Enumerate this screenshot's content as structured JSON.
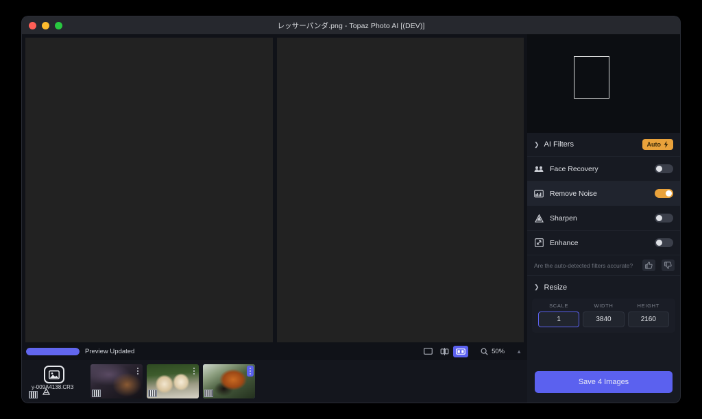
{
  "window": {
    "title": "レッサーパンダ.png - Topaz Photo AI [(DEV)]",
    "traffic_lights": [
      "close",
      "minimize",
      "zoom"
    ]
  },
  "statusbar": {
    "progress_label": "Preview Updated",
    "progress_percent": 100,
    "progress_color": "#6166ee",
    "view_modes": [
      {
        "name": "single-view",
        "icon": "rectangle-icon",
        "active": false
      },
      {
        "name": "split-view",
        "icon": "split-view-icon",
        "active": false
      },
      {
        "name": "side-by-side-view",
        "icon": "side-by-side-icon",
        "active": true
      }
    ],
    "zoom_icon": "magnifier-icon",
    "zoom_value": "50%",
    "caret_icon": "chevron-up-icon"
  },
  "filmstrip": {
    "items": [
      {
        "name": "y-009A4138.CR3",
        "kind": "add-placeholder",
        "selected": false,
        "thumb_class": "t-first"
      },
      {
        "name": "thumbnail-2",
        "kind": "photo",
        "selected": false,
        "thumb_class": "t-dark"
      },
      {
        "name": "thumbnail-3",
        "kind": "photo",
        "selected": false,
        "thumb_class": "t-dogs"
      },
      {
        "name": "thumbnail-4",
        "kind": "photo",
        "selected": true,
        "thumb_class": "t-panda"
      }
    ]
  },
  "navigator": {
    "name": "navigator-preview",
    "viewport_rect": true
  },
  "panel": {
    "ai_filters": {
      "title": "AI Filters",
      "collapse_icon": "chevron-down-icon",
      "auto_badge": {
        "label": "Auto",
        "icon": "lightning-icon",
        "color": "#e9a23b"
      },
      "filters": [
        {
          "label": "Face Recovery",
          "icon": "faces-icon",
          "enabled": false,
          "active": false
        },
        {
          "label": "Remove Noise",
          "icon": "noise-icon",
          "enabled": true,
          "active": true
        },
        {
          "label": "Sharpen",
          "icon": "sharpen-icon",
          "enabled": false,
          "active": false
        },
        {
          "label": "Enhance",
          "icon": "enhance-icon",
          "enabled": false,
          "active": false
        }
      ],
      "feedback": {
        "question": "Are the auto-detected filters accurate?",
        "thumbs_up_icon": "thumbs-up-icon",
        "thumbs_down_icon": "thumbs-down-icon"
      }
    },
    "resize": {
      "title": "Resize",
      "collapse_icon": "chevron-down-icon",
      "fields": [
        {
          "caption": "SCALE",
          "value": "1",
          "focused": true
        },
        {
          "caption": "WIDTH",
          "value": "3840",
          "focused": false
        },
        {
          "caption": "HEIGHT",
          "value": "2160",
          "focused": false
        }
      ]
    },
    "save": {
      "label": "Save 4 Images",
      "color": "#5b61ef"
    }
  }
}
